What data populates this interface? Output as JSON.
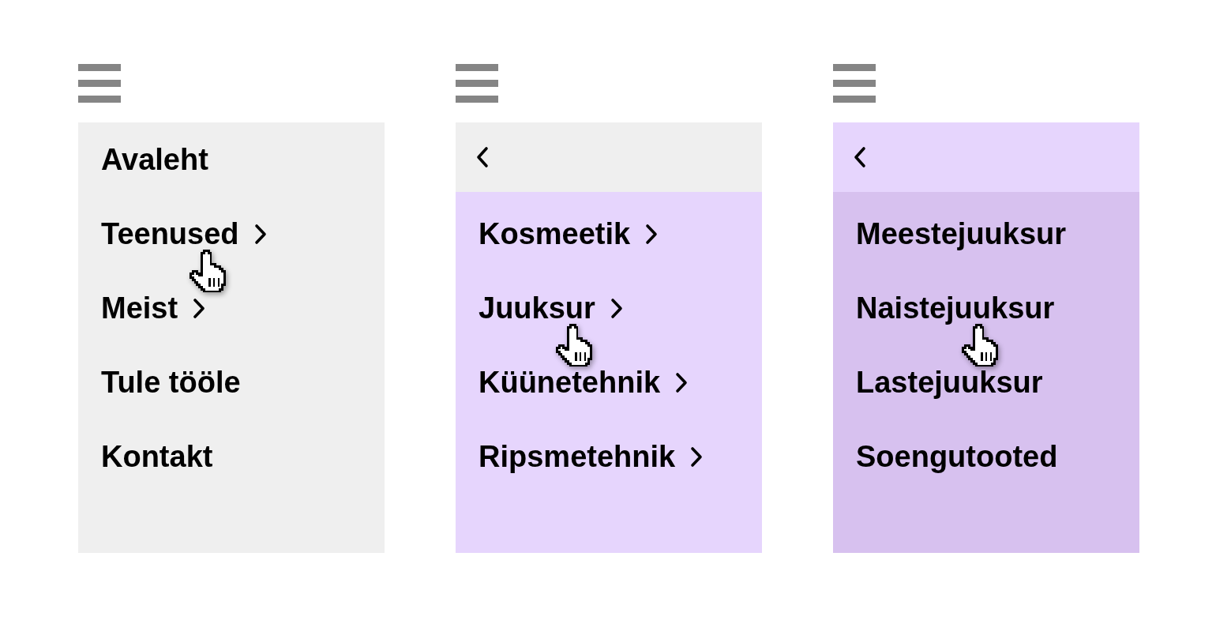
{
  "panels": [
    {
      "back_button": false,
      "items": [
        {
          "label": "Avaleht",
          "submenu": false,
          "hovered": false
        },
        {
          "label": "Teenused",
          "submenu": true,
          "hovered": true
        },
        {
          "label": "Meist",
          "submenu": true,
          "hovered": false
        },
        {
          "label": "Tule tööle",
          "submenu": false,
          "hovered": false
        },
        {
          "label": "Kontakt",
          "submenu": false,
          "hovered": false
        }
      ]
    },
    {
      "back_button": true,
      "items": [
        {
          "label": "Kosmeetik",
          "submenu": true,
          "hovered": false
        },
        {
          "label": "Juuksur",
          "submenu": true,
          "hovered": true
        },
        {
          "label": "Küünetehnik",
          "submenu": true,
          "hovered": false
        },
        {
          "label": "Ripsmetehnik",
          "submenu": true,
          "hovered": false
        }
      ]
    },
    {
      "back_button": true,
      "items": [
        {
          "label": "Meestejuuksur",
          "submenu": false,
          "hovered": false
        },
        {
          "label": "Naistejuuksur",
          "submenu": false,
          "hovered": true
        },
        {
          "label": "Lastejuuksur",
          "submenu": false,
          "hovered": false
        },
        {
          "label": "Soengutooted",
          "submenu": false,
          "hovered": false
        }
      ]
    }
  ]
}
